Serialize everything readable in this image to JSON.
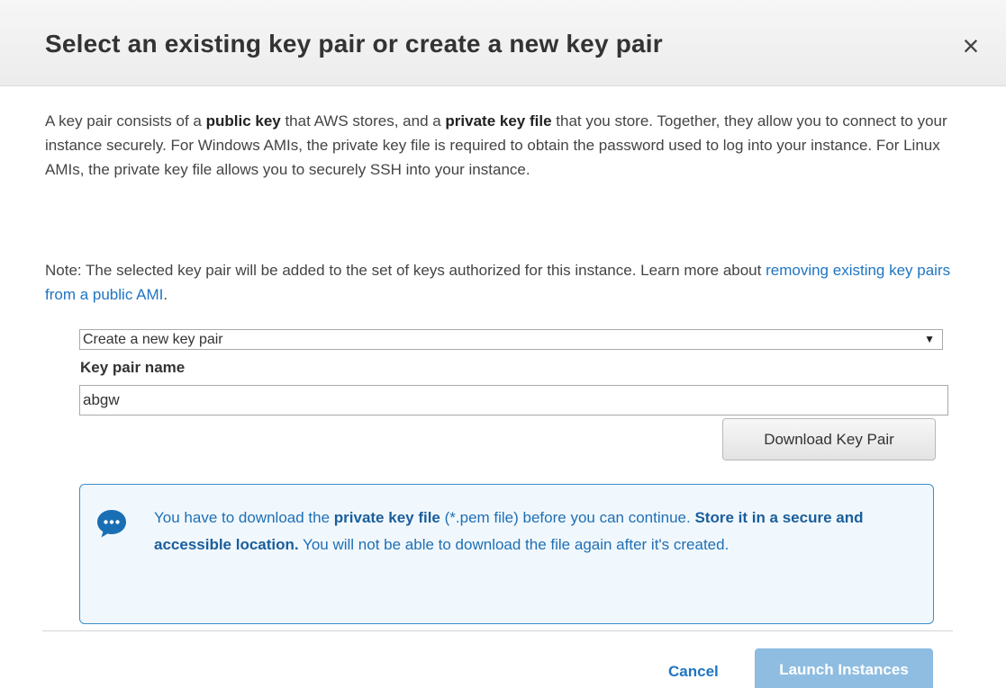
{
  "dialog": {
    "title": "Select an existing key pair or create a new key pair",
    "close_icon": "×"
  },
  "intro": {
    "part1": "A key pair consists of a ",
    "bold1": "public key",
    "part2": " that AWS stores, and a ",
    "bold2": "private key file",
    "part3": " that you store. Together, they allow you to connect to your instance securely. For Windows AMIs, the private key file is required to obtain the password used to log into your instance. For Linux AMIs, the private key file allows you to securely SSH into your instance."
  },
  "note": {
    "text": "Note: The selected key pair will be added to the set of keys authorized for this instance. Learn more about ",
    "link": "removing existing key pairs from a public AMI",
    "end": "."
  },
  "key_select": {
    "selected": "Create a new key pair",
    "arrow": "▼"
  },
  "key_name": {
    "label": "Key pair name",
    "value": "abgw"
  },
  "download_button": "Download Key Pair",
  "info": {
    "icon": "speech-bubble-icon",
    "part1": "You have to download the ",
    "bold1": "private key file",
    "part2": " (*.pem file) before you can continue. ",
    "bold2": "Store it in a secure and accessible location.",
    "part3": " You will not be able to download the file again after it's created."
  },
  "footer": {
    "cancel": "Cancel",
    "launch": "Launch Instances"
  },
  "colors": {
    "link": "#1f75c2",
    "info_border": "#3d8ec9",
    "info_bg": "#f1f8fd",
    "icon_blue": "#1a6fb4",
    "launch_disabled": "#8fbde2"
  }
}
